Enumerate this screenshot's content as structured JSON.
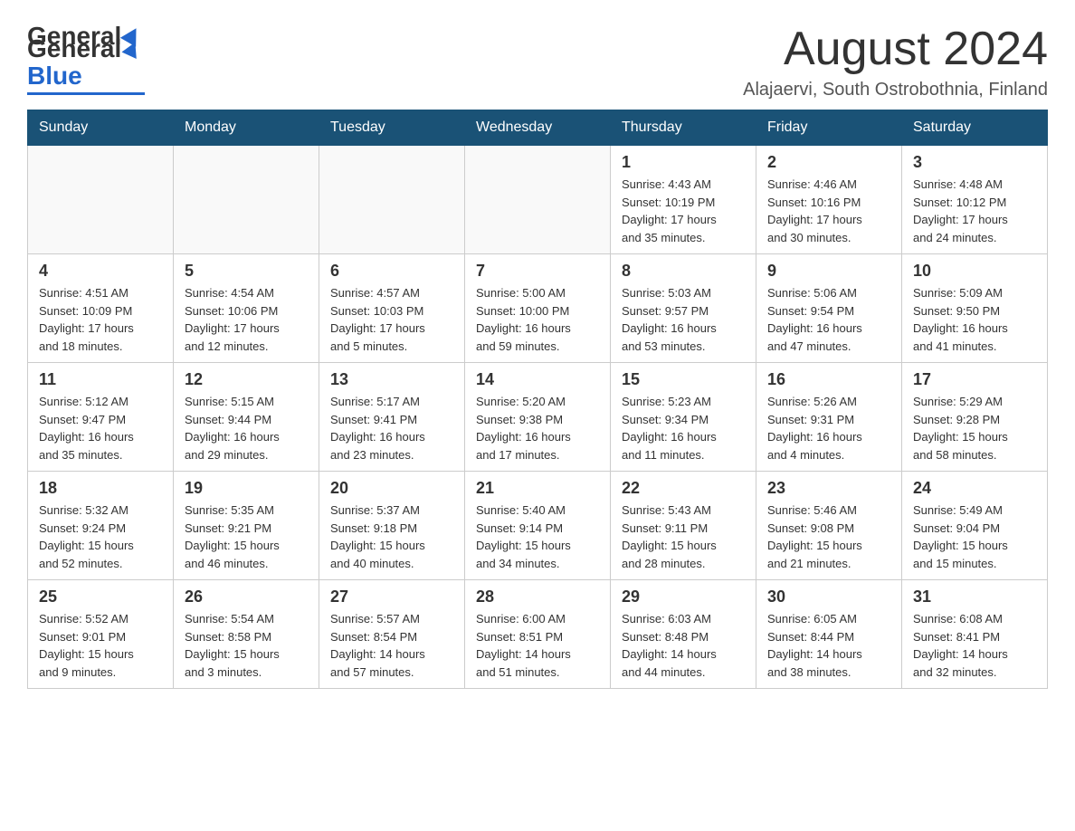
{
  "header": {
    "logo_general": "General",
    "logo_blue": "Blue",
    "month_title": "August 2024",
    "location": "Alajaervi, South Ostrobothnia, Finland"
  },
  "weekdays": [
    "Sunday",
    "Monday",
    "Tuesday",
    "Wednesday",
    "Thursday",
    "Friday",
    "Saturday"
  ],
  "weeks": [
    [
      {
        "day": "",
        "info": ""
      },
      {
        "day": "",
        "info": ""
      },
      {
        "day": "",
        "info": ""
      },
      {
        "day": "",
        "info": ""
      },
      {
        "day": "1",
        "info": "Sunrise: 4:43 AM\nSunset: 10:19 PM\nDaylight: 17 hours\nand 35 minutes."
      },
      {
        "day": "2",
        "info": "Sunrise: 4:46 AM\nSunset: 10:16 PM\nDaylight: 17 hours\nand 30 minutes."
      },
      {
        "day": "3",
        "info": "Sunrise: 4:48 AM\nSunset: 10:12 PM\nDaylight: 17 hours\nand 24 minutes."
      }
    ],
    [
      {
        "day": "4",
        "info": "Sunrise: 4:51 AM\nSunset: 10:09 PM\nDaylight: 17 hours\nand 18 minutes."
      },
      {
        "day": "5",
        "info": "Sunrise: 4:54 AM\nSunset: 10:06 PM\nDaylight: 17 hours\nand 12 minutes."
      },
      {
        "day": "6",
        "info": "Sunrise: 4:57 AM\nSunset: 10:03 PM\nDaylight: 17 hours\nand 5 minutes."
      },
      {
        "day": "7",
        "info": "Sunrise: 5:00 AM\nSunset: 10:00 PM\nDaylight: 16 hours\nand 59 minutes."
      },
      {
        "day": "8",
        "info": "Sunrise: 5:03 AM\nSunset: 9:57 PM\nDaylight: 16 hours\nand 53 minutes."
      },
      {
        "day": "9",
        "info": "Sunrise: 5:06 AM\nSunset: 9:54 PM\nDaylight: 16 hours\nand 47 minutes."
      },
      {
        "day": "10",
        "info": "Sunrise: 5:09 AM\nSunset: 9:50 PM\nDaylight: 16 hours\nand 41 minutes."
      }
    ],
    [
      {
        "day": "11",
        "info": "Sunrise: 5:12 AM\nSunset: 9:47 PM\nDaylight: 16 hours\nand 35 minutes."
      },
      {
        "day": "12",
        "info": "Sunrise: 5:15 AM\nSunset: 9:44 PM\nDaylight: 16 hours\nand 29 minutes."
      },
      {
        "day": "13",
        "info": "Sunrise: 5:17 AM\nSunset: 9:41 PM\nDaylight: 16 hours\nand 23 minutes."
      },
      {
        "day": "14",
        "info": "Sunrise: 5:20 AM\nSunset: 9:38 PM\nDaylight: 16 hours\nand 17 minutes."
      },
      {
        "day": "15",
        "info": "Sunrise: 5:23 AM\nSunset: 9:34 PM\nDaylight: 16 hours\nand 11 minutes."
      },
      {
        "day": "16",
        "info": "Sunrise: 5:26 AM\nSunset: 9:31 PM\nDaylight: 16 hours\nand 4 minutes."
      },
      {
        "day": "17",
        "info": "Sunrise: 5:29 AM\nSunset: 9:28 PM\nDaylight: 15 hours\nand 58 minutes."
      }
    ],
    [
      {
        "day": "18",
        "info": "Sunrise: 5:32 AM\nSunset: 9:24 PM\nDaylight: 15 hours\nand 52 minutes."
      },
      {
        "day": "19",
        "info": "Sunrise: 5:35 AM\nSunset: 9:21 PM\nDaylight: 15 hours\nand 46 minutes."
      },
      {
        "day": "20",
        "info": "Sunrise: 5:37 AM\nSunset: 9:18 PM\nDaylight: 15 hours\nand 40 minutes."
      },
      {
        "day": "21",
        "info": "Sunrise: 5:40 AM\nSunset: 9:14 PM\nDaylight: 15 hours\nand 34 minutes."
      },
      {
        "day": "22",
        "info": "Sunrise: 5:43 AM\nSunset: 9:11 PM\nDaylight: 15 hours\nand 28 minutes."
      },
      {
        "day": "23",
        "info": "Sunrise: 5:46 AM\nSunset: 9:08 PM\nDaylight: 15 hours\nand 21 minutes."
      },
      {
        "day": "24",
        "info": "Sunrise: 5:49 AM\nSunset: 9:04 PM\nDaylight: 15 hours\nand 15 minutes."
      }
    ],
    [
      {
        "day": "25",
        "info": "Sunrise: 5:52 AM\nSunset: 9:01 PM\nDaylight: 15 hours\nand 9 minutes."
      },
      {
        "day": "26",
        "info": "Sunrise: 5:54 AM\nSunset: 8:58 PM\nDaylight: 15 hours\nand 3 minutes."
      },
      {
        "day": "27",
        "info": "Sunrise: 5:57 AM\nSunset: 8:54 PM\nDaylight: 14 hours\nand 57 minutes."
      },
      {
        "day": "28",
        "info": "Sunrise: 6:00 AM\nSunset: 8:51 PM\nDaylight: 14 hours\nand 51 minutes."
      },
      {
        "day": "29",
        "info": "Sunrise: 6:03 AM\nSunset: 8:48 PM\nDaylight: 14 hours\nand 44 minutes."
      },
      {
        "day": "30",
        "info": "Sunrise: 6:05 AM\nSunset: 8:44 PM\nDaylight: 14 hours\nand 38 minutes."
      },
      {
        "day": "31",
        "info": "Sunrise: 6:08 AM\nSunset: 8:41 PM\nDaylight: 14 hours\nand 32 minutes."
      }
    ]
  ]
}
